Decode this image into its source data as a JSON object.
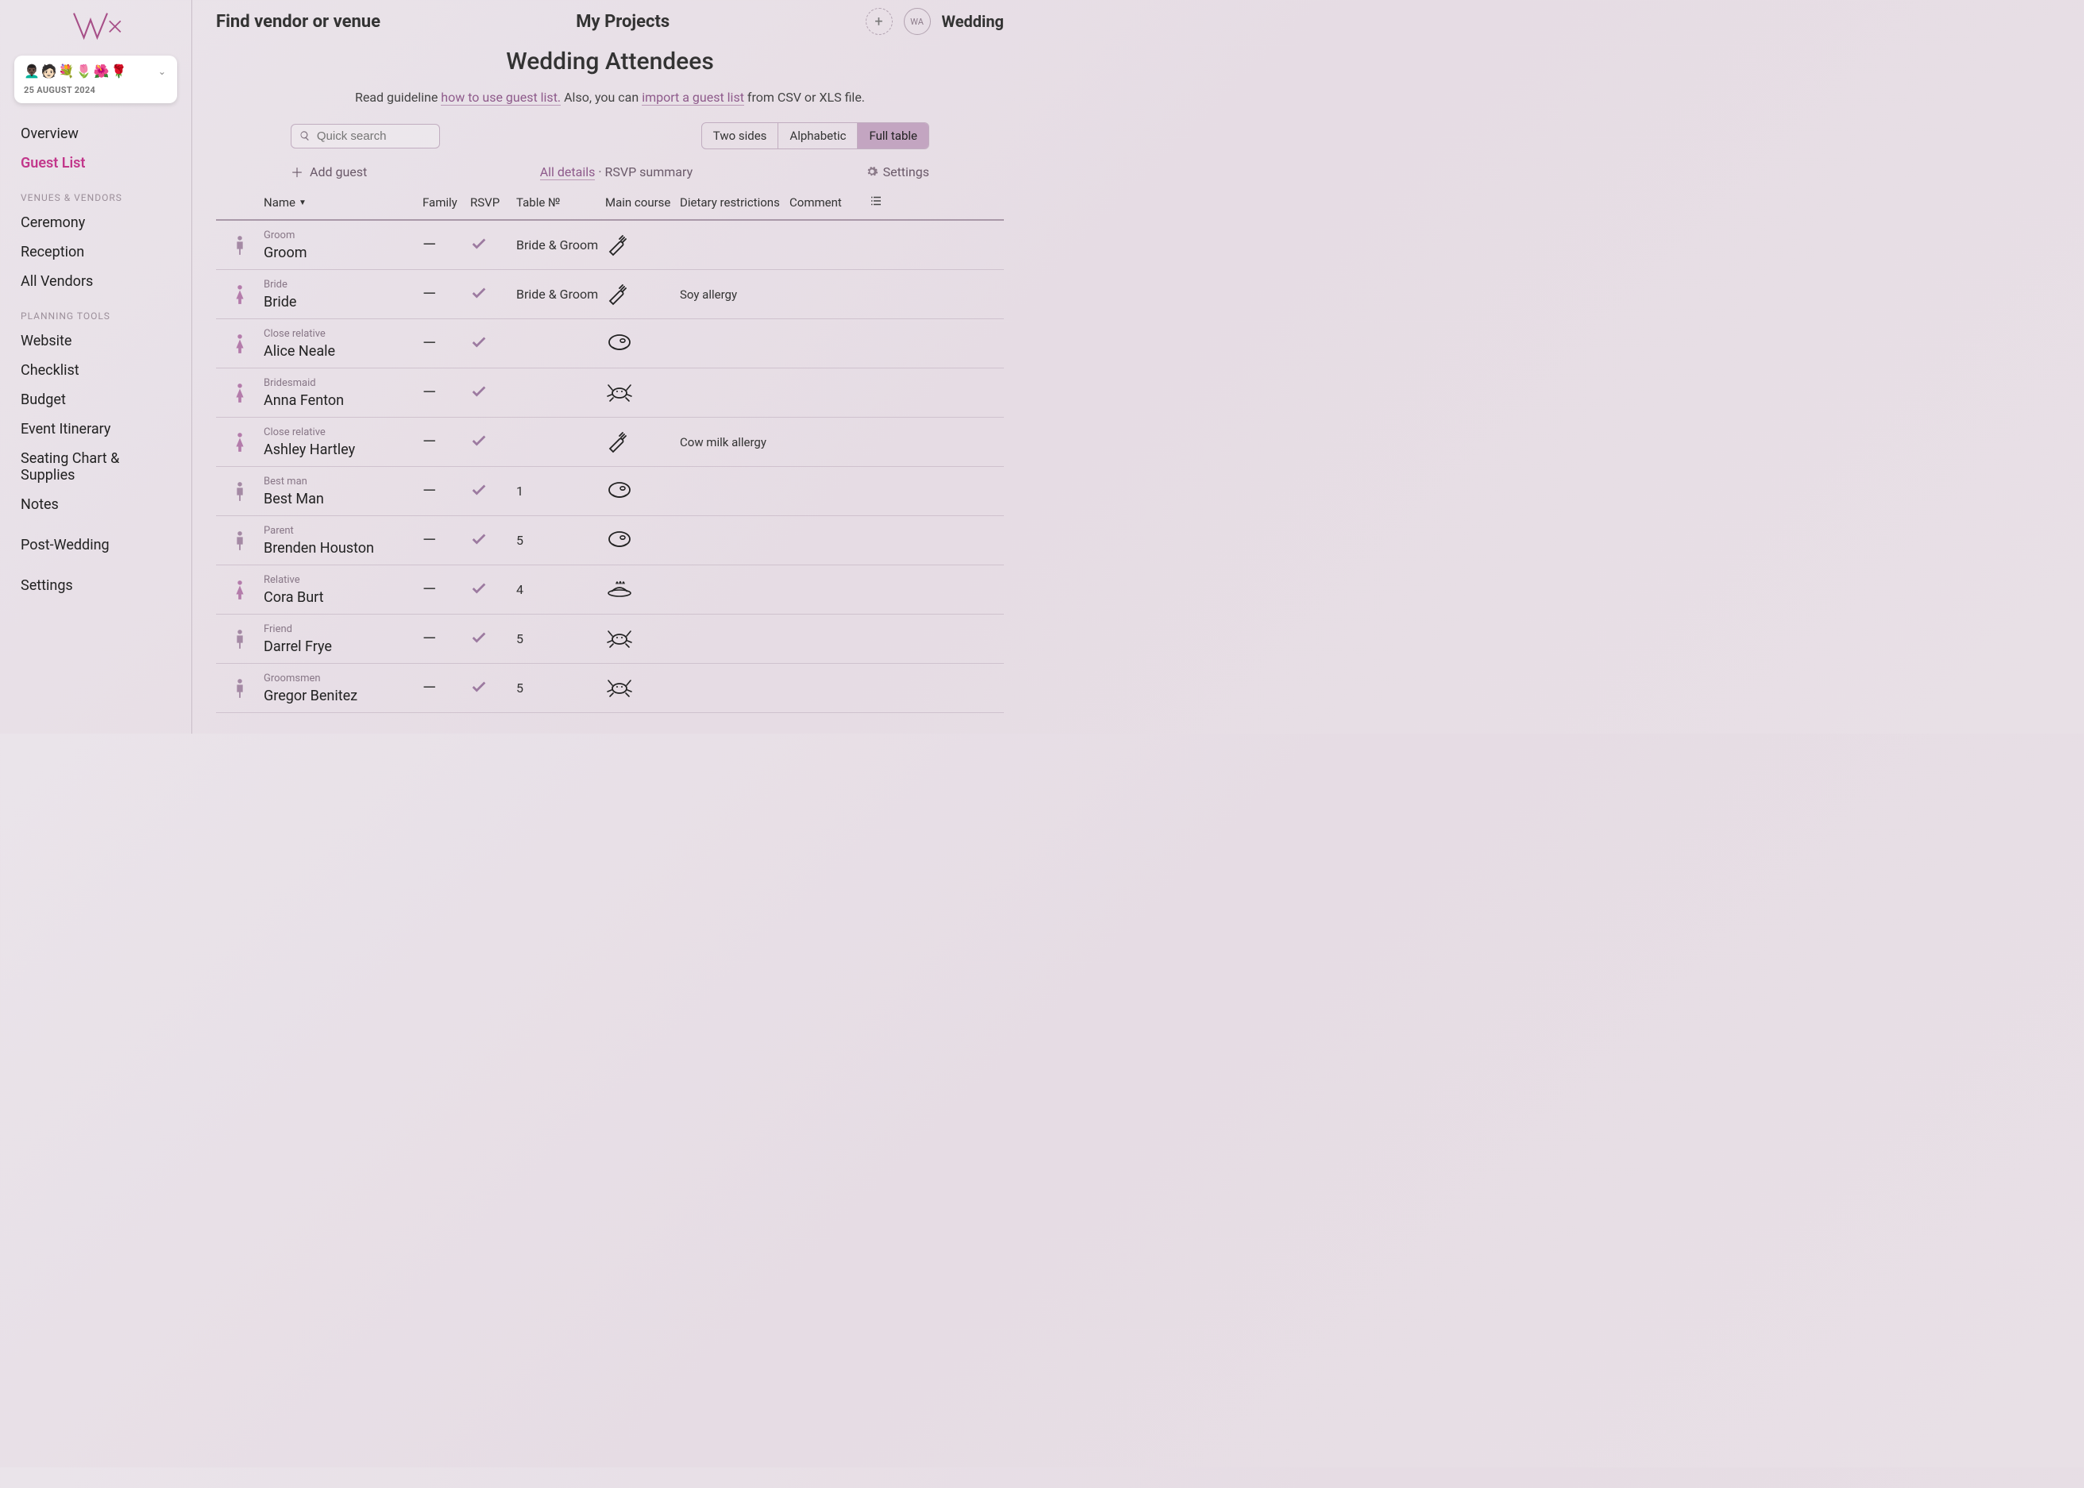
{
  "logo_initials": "WA",
  "project_card": {
    "emojis": "👨🏿‍🦱🧑🏻💐🌷🌺🌹",
    "date": "25 AUGUST 2024"
  },
  "sidebar": {
    "items_top": [
      {
        "label": "Overview"
      },
      {
        "label": "Guest List",
        "active": true
      }
    ],
    "section1_title": "VENUES & VENDORS",
    "items_venues": [
      "Ceremony",
      "Reception",
      "All Vendors"
    ],
    "section2_title": "PLANNING TOOLS",
    "items_planning": [
      "Website",
      "Checklist",
      "Budget",
      "Event Itinerary",
      "Seating Chart & Supplies",
      "Notes"
    ],
    "items_bottom": [
      "Post-Wedding",
      "Settings"
    ]
  },
  "top": {
    "find": "Find vendor or venue",
    "projects": "My Projects",
    "name": "Wedding"
  },
  "page_title": "Wedding Attendees",
  "guideline": {
    "pre": "Read guideline ",
    "link1": "how to use guest list.",
    "mid": " Also, you can ",
    "link2": "import a guest list",
    "post": " from CSV or XLS file."
  },
  "search_placeholder": "Quick search",
  "views": {
    "a": "Two sides",
    "b": "Alphabetic",
    "c": "Full table"
  },
  "add_guest": "Add guest",
  "details": {
    "all": "All details",
    "rsvp": "RSVP summary"
  },
  "settings": "Settings",
  "columns": {
    "name": "Name",
    "family": "Family",
    "rsvp": "RSVP",
    "table": "Table №",
    "main": "Main course",
    "diet": "Dietary restrictions",
    "comment": "Comment"
  },
  "guests": [
    {
      "role": "Groom",
      "name": "Groom",
      "gender": "m",
      "family": "—",
      "rsvp": true,
      "table": "Bride & Groom",
      "meal": "carrot",
      "diet": ""
    },
    {
      "role": "Bride",
      "name": "Bride",
      "gender": "f",
      "family": "—",
      "rsvp": true,
      "table": "Bride & Groom",
      "meal": "carrot",
      "diet": "Soy allergy"
    },
    {
      "role": "Close relative",
      "name": "Alice Neale",
      "gender": "f",
      "family": "—",
      "rsvp": true,
      "table": "",
      "meal": "steak",
      "diet": ""
    },
    {
      "role": "Bridesmaid",
      "name": "Anna Fenton",
      "gender": "f",
      "family": "—",
      "rsvp": true,
      "table": "",
      "meal": "crab",
      "diet": ""
    },
    {
      "role": "Close relative",
      "name": "Ashley Hartley",
      "gender": "f",
      "family": "—",
      "rsvp": true,
      "table": "",
      "meal": "carrot",
      "diet": "Cow milk allergy"
    },
    {
      "role": "Best man",
      "name": "Best Man",
      "gender": "m",
      "family": "—",
      "rsvp": true,
      "table": "1",
      "meal": "steak",
      "diet": ""
    },
    {
      "role": "Parent",
      "name": "Brenden Houston",
      "gender": "m",
      "family": "—",
      "rsvp": true,
      "table": "5",
      "meal": "steak",
      "diet": ""
    },
    {
      "role": "Relative",
      "name": "Cora Burt",
      "gender": "f",
      "family": "—",
      "rsvp": true,
      "table": "4",
      "meal": "dish",
      "diet": ""
    },
    {
      "role": "Friend",
      "name": "Darrel Frye",
      "gender": "m",
      "family": "—",
      "rsvp": true,
      "table": "5",
      "meal": "crab",
      "diet": ""
    },
    {
      "role": "Groomsmen",
      "name": "Gregor Benitez",
      "gender": "m",
      "family": "—",
      "rsvp": true,
      "table": "5",
      "meal": "crab",
      "diet": ""
    }
  ]
}
